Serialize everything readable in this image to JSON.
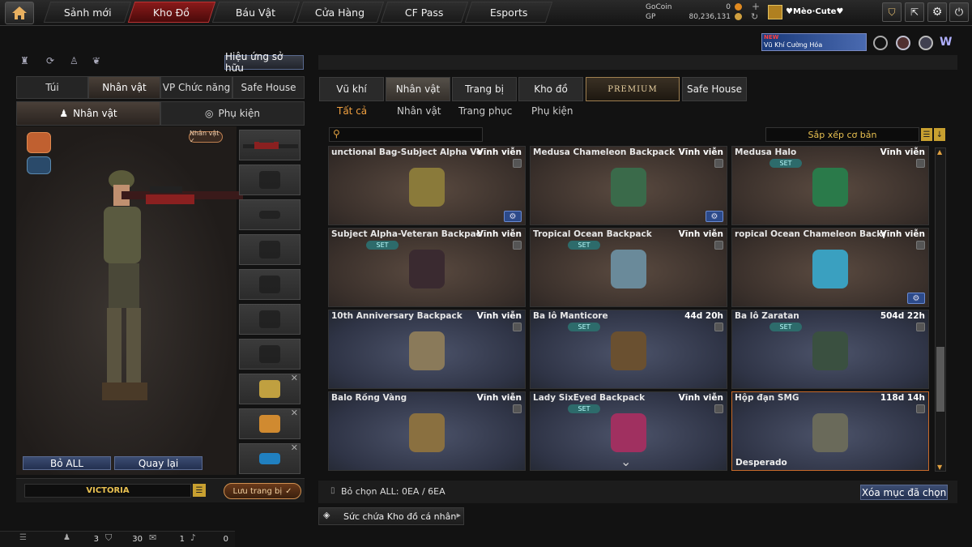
{
  "topnav": {
    "tabs": [
      "Sảnh mới",
      "Kho Đồ",
      "Báu Vật",
      "Cửa Hàng",
      "CF Pass",
      "Esports"
    ],
    "active_index": 1,
    "gocoin_label": "GoCoin",
    "gocoin_value": "0",
    "gp_label": "GP",
    "gp_value": "80,236,131",
    "username": "♥Mèo·Cute♥"
  },
  "promo": {
    "badge": "NEW",
    "text": "Vũ Khí Cường Hóa"
  },
  "left": {
    "effects_button": "Hiệu ứng sở hữu",
    "tabs": [
      "Túi",
      "Nhân vật",
      "VP Chức năng",
      "Safe House"
    ],
    "active_tab": 1,
    "subtabs": [
      "Nhân vật",
      "Phụ kiện"
    ],
    "active_subtab": 0,
    "character_badge": "Nhân vật ✓",
    "reset_button": "Bỏ ALL",
    "back_button": "Quay lại",
    "character_name": "VICTORIA",
    "save_button": "Lưu trang bị"
  },
  "right": {
    "tabs": [
      "Vũ khí",
      "Nhân vật",
      "Trang bị",
      "Kho đồ",
      "PREMIUM",
      "Safe House"
    ],
    "active_tab": 1,
    "subtabs": [
      "Tất cả",
      "Nhân vật",
      "Trang phục",
      "Phụ kiện"
    ],
    "active_subtab": 0,
    "search_placeholder": "",
    "sort_label": "Sắp xếp cơ bản",
    "items": [
      {
        "name": "unctional Bag-Subject Alpha Veter:",
        "duration": "Vĩnh viễn",
        "theme": "brown",
        "set": false,
        "gear": true,
        "icon": "backpack-icon",
        "color": "#8a7a3a"
      },
      {
        "name": "Medusa Chameleon Backpack",
        "duration": "Vĩnh viễn",
        "theme": "brown",
        "set": false,
        "gear": true,
        "icon": "backpack-icon",
        "color": "#3a6a4a"
      },
      {
        "name": "Medusa Halo",
        "duration": "Vĩnh viễn",
        "theme": "brown",
        "set": true,
        "gear": false,
        "icon": "halo-icon",
        "color": "#2a7a4a"
      },
      {
        "name": "Subject Alpha-Veteran Backpack",
        "duration": "Vĩnh viễn",
        "theme": "brown",
        "set": true,
        "gear": false,
        "icon": "doll-icon",
        "color": "#3a2a30"
      },
      {
        "name": "Tropical Ocean Backpack",
        "duration": "Vĩnh viễn",
        "theme": "brown",
        "set": true,
        "gear": false,
        "icon": "robot-icon",
        "color": "#6a8a9a"
      },
      {
        "name": "ropical Ocean Chameleon Backpac",
        "duration": "Vĩnh viễn",
        "theme": "brown",
        "set": false,
        "gear": true,
        "icon": "backpack-icon",
        "color": "#3aa0c0"
      },
      {
        "name": "10th Anniversary Backpack",
        "duration": "Vĩnh viễn",
        "theme": "blue",
        "set": false,
        "gear": false,
        "icon": "backpack-icon",
        "color": "#8a7a5a"
      },
      {
        "name": "Ba lô Manticore",
        "duration": "44d 20h",
        "theme": "blue",
        "set": true,
        "gear": false,
        "icon": "manticore-icon",
        "color": "#6a5030"
      },
      {
        "name": "Ba lô Zaratan",
        "duration": "504d 22h",
        "theme": "blue",
        "set": true,
        "gear": false,
        "icon": "turtle-icon",
        "color": "#3a5040"
      },
      {
        "name": "Balo Rồng Vàng",
        "duration": "Vĩnh viễn",
        "theme": "blue",
        "set": false,
        "gear": false,
        "icon": "backpack-icon",
        "color": "#8a7040"
      },
      {
        "name": "Lady SixEyed Backpack",
        "duration": "Vĩnh viễn",
        "theme": "blue",
        "set": true,
        "gear": false,
        "icon": "doll-icon",
        "color": "#a03060"
      },
      {
        "name": "Hộp đạn SMG",
        "duration": "118d 14h",
        "theme": "blue",
        "set": false,
        "gear": false,
        "icon": "ammo-box-icon",
        "color": "#6a6a5a",
        "footer": "Desperado",
        "selected": true
      }
    ],
    "selected_count": "Bỏ chọn ALL: 0EA / 6EA",
    "delete_button": "Xóa mục đã chọn",
    "storage_button": "Sức chứa Kho đồ cá nhân"
  },
  "statusbar": {
    "count_a": "3",
    "count_b": "30",
    "count_c": "1",
    "count_d": "0"
  }
}
